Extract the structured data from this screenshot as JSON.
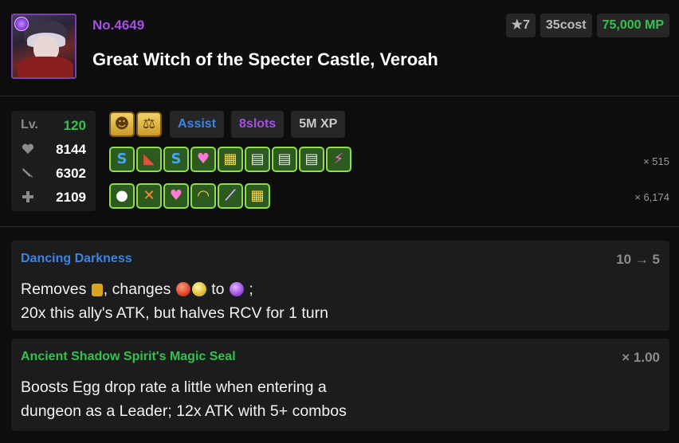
{
  "header": {
    "number": "No.4649",
    "name": "Great Witch of the Specter Castle, Veroah",
    "rarity": "★7",
    "cost": "35cost",
    "mp": "75,000 MP"
  },
  "stats": {
    "level_label": "Lv.",
    "level": "120",
    "hp": "8144",
    "atk": "6302",
    "rcv": "2109"
  },
  "badges": {
    "type_icons": [
      "devil-type-icon",
      "balanced-type-icon"
    ],
    "assist": "Assist",
    "slots": "8slots",
    "xp": "5M XP"
  },
  "awakenings": {
    "row1": [
      "skill-boost-plus-icon",
      "spike-shield-icon",
      "skill-boost-minus-icon",
      "team-heal-icon",
      "rainbow-orb-icon",
      "no-skill-delay-icon",
      "no-skill-delay-icon",
      "no-skill-delay-icon",
      "guard-break-icon"
    ],
    "row1_count": "× 515",
    "row2": [
      "egg-drop-icon",
      "jammer-icon",
      "team-heal-icon",
      "team-buff-icon",
      "poison-resist-icon",
      "rainbow-orb-icon"
    ],
    "row2_count": "× 6,174"
  },
  "active_skill": {
    "name": "Dancing Darkness",
    "cooldown": "10 → 5",
    "line1_a": "Removes",
    "line1_b": ", changes",
    "line1_c": "to",
    "line1_d": ";",
    "line2": "20x this ally's ATK, but halves RCV for 1 turn"
  },
  "leader_skill": {
    "name": "Ancient Shadow Spirit's Magic Seal",
    "multiplier": "× 1.00",
    "line1": "Boosts Egg drop rate a little when entering a",
    "line2": "dungeon as a Leader; 12x ATK with 5+ combos"
  },
  "colors": {
    "purple": "#a74ee8",
    "green": "#33c24d",
    "blue": "#3b84e6",
    "panel": "#1c1c1c"
  }
}
